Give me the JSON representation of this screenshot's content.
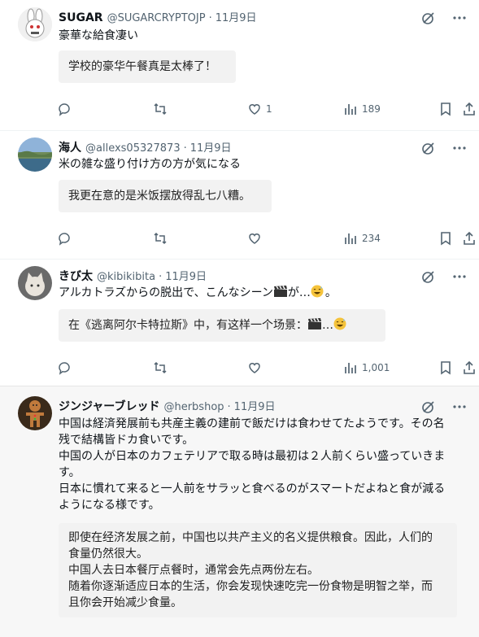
{
  "posts": [
    {
      "name": "SUGAR",
      "handle": "@SUGARCRYPTOJP",
      "date": "11月9日",
      "text": "豪華な給食凄い",
      "translation": "学校的豪华午餐真是太棒了！",
      "actions": {
        "replies": "",
        "reposts": "",
        "likes": "1",
        "views": "189"
      }
    },
    {
      "name": "海人",
      "handle": "@allexs05327873",
      "date": "11月9日",
      "text": "米の雑な盛り付け方の方が気になる",
      "translation": "我更在意的是米饭摆放得乱七八糟。",
      "actions": {
        "replies": "",
        "reposts": "",
        "likes": "",
        "views": "234"
      }
    },
    {
      "name": "きび太",
      "handle": "@kibikibita",
      "date": "11月9日",
      "text": "アルカトラズからの脱出で、こんなシーン",
      "text_suffix": "が…",
      "text_end": "。",
      "translation": "在《逃离阿尔卡特拉斯》中，有这样一个场景：",
      "translation_suffix": "…",
      "actions": {
        "replies": "",
        "reposts": "",
        "likes": "",
        "views": "1,001"
      }
    },
    {
      "name": "ジンジャーブレッド",
      "handle": "@herbshop",
      "date": "11月9日",
      "text_lines": [
        "中国は経済発展前も共産主義の建前で飯だけは食わせてたようです。その名",
        "残で結構皆ドカ食いです。",
        "中国の人が日本のカフェテリアで取る時は最初は２人前くらい盛っていきま",
        "す。",
        "日本に慣れて来ると一人前をサラッと食べるのがスマートだよねと食が減る",
        "ようになる様です。"
      ],
      "translation_lines": [
        "即使在经济发展之前，中国也以共产主义的名义提供粮食。因此，人们的",
        "食量仍然很大。",
        "中国人去日本餐厅点餐时，通常会先点两份左右。",
        "随着你逐渐适应日本的生活，你会发现快速吃完一份食物是明智之举，而",
        "且你会开始减少食量。"
      ]
    }
  ],
  "icons": {
    "reply": "reply-icon",
    "repost": "repost-icon",
    "like": "like-icon",
    "views": "views-icon",
    "bookmark": "bookmark-icon",
    "share": "share-icon",
    "grok": "grok-icon",
    "more": "more-icon"
  },
  "colors": {
    "text": "#0f1419",
    "muted": "#536471"
  }
}
